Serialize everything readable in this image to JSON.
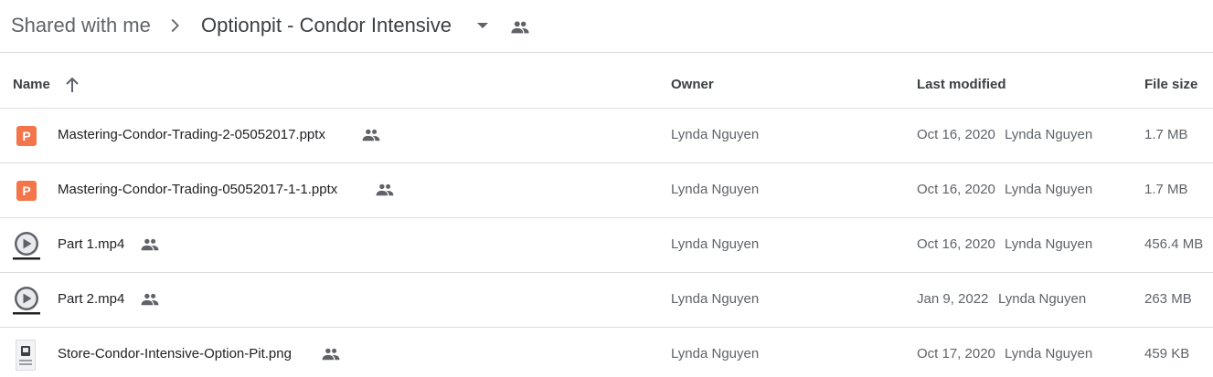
{
  "breadcrumb": {
    "root": "Shared with me",
    "current": "Optionpit - Condor Intensive",
    "separator_icon": "chevron-right-icon",
    "caret_icon": "caret-down-icon",
    "shared_icon": "people-icon"
  },
  "columns": {
    "name": "Name",
    "owner": "Owner",
    "last_modified": "Last modified",
    "file_size": "File size",
    "sort_icon": "arrow-up-icon"
  },
  "files": [
    {
      "name": "Mastering-Condor-Trading-2-05052017.pptx",
      "type_icon": "powerpoint-icon",
      "type_letter": "P",
      "owner": "Lynda Nguyen",
      "modified_date": "Oct 16, 2020",
      "modified_by": "Lynda Nguyen",
      "size": "1.7 MB"
    },
    {
      "name": "Mastering-Condor-Trading-05052017-1-1.pptx",
      "type_icon": "powerpoint-icon",
      "type_letter": "P",
      "owner": "Lynda Nguyen",
      "modified_date": "Oct 16, 2020",
      "modified_by": "Lynda Nguyen",
      "size": "1.7 MB"
    },
    {
      "name": "Part 1.mp4",
      "type_icon": "video-icon",
      "owner": "Lynda Nguyen",
      "modified_date": "Oct 16, 2020",
      "modified_by": "Lynda Nguyen",
      "size": "456.4 MB"
    },
    {
      "name": "Part 2.mp4",
      "type_icon": "video-icon",
      "owner": "Lynda Nguyen",
      "modified_date": "Jan 9, 2022",
      "modified_by": "Lynda Nguyen",
      "size": "263 MB"
    },
    {
      "name": "Store-Condor-Intensive-Option-Pit.png",
      "type_icon": "image-thumbnail-icon",
      "owner": "Lynda Nguyen",
      "modified_date": "Oct 17, 2020",
      "modified_by": "Lynda Nguyen",
      "size": "459 KB"
    }
  ],
  "colors": {
    "ppt_orange": "#f4754a",
    "divider": "#dadce0",
    "secondary_text": "#5f6368"
  }
}
